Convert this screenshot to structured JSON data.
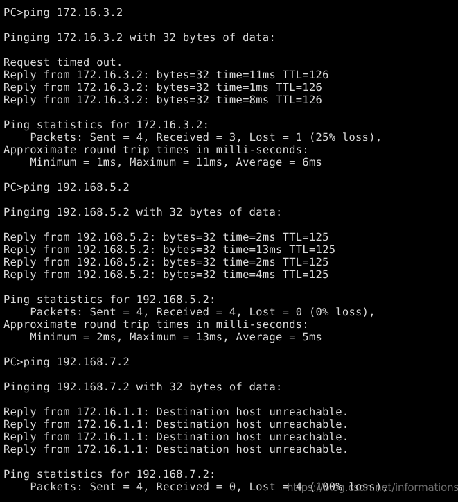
{
  "terminal": {
    "prompt": "PC>",
    "background_color": "#000000",
    "text_color": "#d9d9d9",
    "watermark": {
      "text": "https://blog.csdn.net/informationss",
      "color": "#c8c8c8"
    },
    "lines": [
      "PC>ping 172.16.3.2",
      "",
      "Pinging 172.16.3.2 with 32 bytes of data:",
      "",
      "Request timed out.",
      "Reply from 172.16.3.2: bytes=32 time=11ms TTL=126",
      "Reply from 172.16.3.2: bytes=32 time=1ms TTL=126",
      "Reply from 172.16.3.2: bytes=32 time=8ms TTL=126",
      "",
      "Ping statistics for 172.16.3.2:",
      "    Packets: Sent = 4, Received = 3, Lost = 1 (25% loss),",
      "Approximate round trip times in milli-seconds:",
      "    Minimum = 1ms, Maximum = 11ms, Average = 6ms",
      "",
      "PC>ping 192.168.5.2",
      "",
      "Pinging 192.168.5.2 with 32 bytes of data:",
      "",
      "Reply from 192.168.5.2: bytes=32 time=2ms TTL=125",
      "Reply from 192.168.5.2: bytes=32 time=13ms TTL=125",
      "Reply from 192.168.5.2: bytes=32 time=2ms TTL=125",
      "Reply from 192.168.5.2: bytes=32 time=4ms TTL=125",
      "",
      "Ping statistics for 192.168.5.2:",
      "    Packets: Sent = 4, Received = 4, Lost = 0 (0% loss),",
      "Approximate round trip times in milli-seconds:",
      "    Minimum = 2ms, Maximum = 13ms, Average = 5ms",
      "",
      "PC>ping 192.168.7.2",
      "",
      "Pinging 192.168.7.2 with 32 bytes of data:",
      "",
      "Reply from 172.16.1.1: Destination host unreachable.",
      "Reply from 172.16.1.1: Destination host unreachable.",
      "Reply from 172.16.1.1: Destination host unreachable.",
      "Reply from 172.16.1.1: Destination host unreachable.",
      "",
      "Ping statistics for 192.168.7.2:",
      "    Packets: Sent = 4, Received = 0, Lost = 4 (100% loss),"
    ],
    "sessions": [
      {
        "command": "ping 172.16.3.2",
        "target": "172.16.3.2",
        "payload_bytes": 32,
        "replies": [
          {
            "status": "timeout",
            "text": "Request timed out."
          },
          {
            "status": "reply",
            "from": "172.16.3.2",
            "bytes": 32,
            "time_ms": 11,
            "ttl": 126
          },
          {
            "status": "reply",
            "from": "172.16.3.2",
            "bytes": 32,
            "time_ms": 1,
            "ttl": 126
          },
          {
            "status": "reply",
            "from": "172.16.3.2",
            "bytes": 32,
            "time_ms": 8,
            "ttl": 126
          }
        ],
        "statistics": {
          "sent": 4,
          "received": 3,
          "lost": 1,
          "loss_percent": "25%",
          "minimum_ms": 1,
          "maximum_ms": 11,
          "average_ms": 6
        }
      },
      {
        "command": "ping 192.168.5.2",
        "target": "192.168.5.2",
        "payload_bytes": 32,
        "replies": [
          {
            "status": "reply",
            "from": "192.168.5.2",
            "bytes": 32,
            "time_ms": 2,
            "ttl": 125
          },
          {
            "status": "reply",
            "from": "192.168.5.2",
            "bytes": 32,
            "time_ms": 13,
            "ttl": 125
          },
          {
            "status": "reply",
            "from": "192.168.5.2",
            "bytes": 32,
            "time_ms": 2,
            "ttl": 125
          },
          {
            "status": "reply",
            "from": "192.168.5.2",
            "bytes": 32,
            "time_ms": 4,
            "ttl": 125
          }
        ],
        "statistics": {
          "sent": 4,
          "received": 4,
          "lost": 0,
          "loss_percent": "0%",
          "minimum_ms": 2,
          "maximum_ms": 13,
          "average_ms": 5
        }
      },
      {
        "command": "ping 192.168.7.2",
        "target": "192.168.7.2",
        "payload_bytes": 32,
        "replies": [
          {
            "status": "unreachable",
            "from": "172.16.1.1",
            "text": "Destination host unreachable."
          },
          {
            "status": "unreachable",
            "from": "172.16.1.1",
            "text": "Destination host unreachable."
          },
          {
            "status": "unreachable",
            "from": "172.16.1.1",
            "text": "Destination host unreachable."
          },
          {
            "status": "unreachable",
            "from": "172.16.1.1",
            "text": "Destination host unreachable."
          }
        ],
        "statistics": {
          "sent": 4,
          "received": 0,
          "lost": 4,
          "loss_percent": "100%"
        }
      }
    ]
  }
}
